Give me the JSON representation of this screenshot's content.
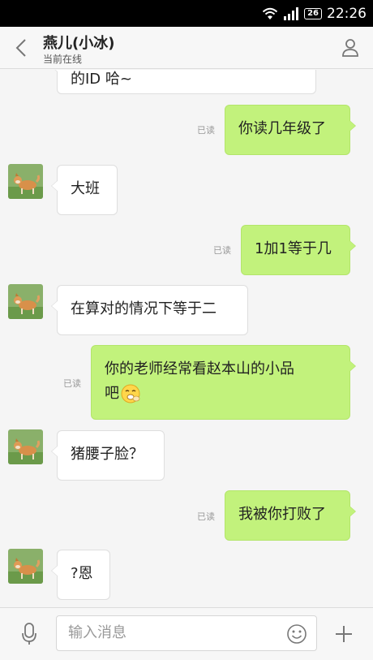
{
  "status_bar": {
    "battery": "26",
    "time": "22:26"
  },
  "header": {
    "title": "燕儿(小冰)",
    "subtitle": "当前在线"
  },
  "messages": [
    {
      "side": "left",
      "text": "的ID 哈~",
      "partial": true
    },
    {
      "side": "right",
      "text": "你读几年级了",
      "read": "已读"
    },
    {
      "side": "left",
      "text": "大班",
      "avatar": "shiba-dog-avatar"
    },
    {
      "side": "right",
      "text": "1加1等于几",
      "read": "已读"
    },
    {
      "side": "left",
      "text": "在算对的情况下等于二",
      "avatar": "shiba-dog-avatar"
    },
    {
      "side": "right",
      "text_line1": "你的老师经常看赵本山的小品",
      "text_line2": "吧",
      "emoji": "giggling-face-emoji",
      "read": "已读"
    },
    {
      "side": "left",
      "text": "猪腰子脸？",
      "avatar": "shiba-dog-avatar"
    },
    {
      "side": "right",
      "text": "我被你打败了",
      "read": "已读"
    },
    {
      "side": "left",
      "text": "?恩",
      "avatar": "shiba-dog-avatar"
    }
  ],
  "input_bar": {
    "placeholder": "输入消息"
  },
  "colors": {
    "sent_bubble": "#c2f27c",
    "received_bubble": "#ffffff",
    "background": "#f5f5f5"
  }
}
